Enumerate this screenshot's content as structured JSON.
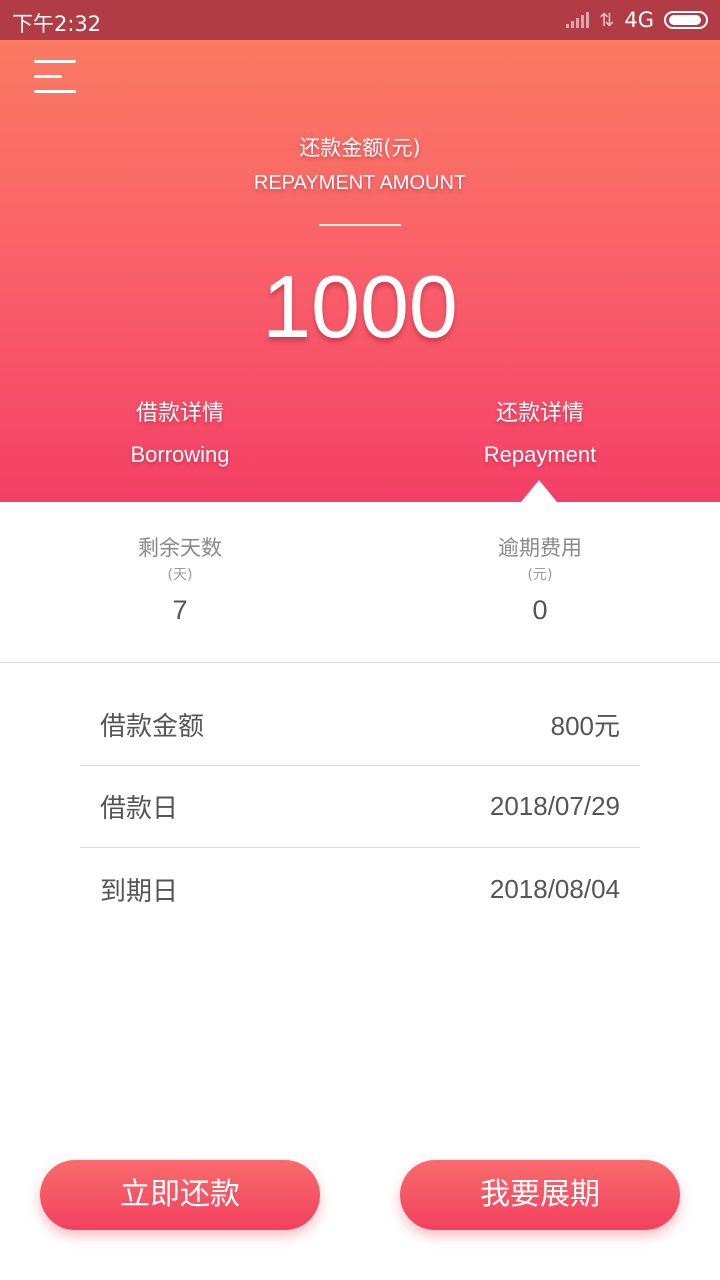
{
  "status_bar": {
    "time": "下午2:32",
    "network": "4G"
  },
  "hero": {
    "title_cn": "还款金额(元)",
    "title_en": "REPAYMENT AMOUNT",
    "amount": "1000",
    "tabs": [
      {
        "cn": "借款详情",
        "en": "Borrowing",
        "active": false
      },
      {
        "cn": "还款详情",
        "en": "Repayment",
        "active": true
      }
    ]
  },
  "stats": [
    {
      "label": "剩余天数",
      "unit": "(天)",
      "value": "7"
    },
    {
      "label": "逾期费用",
      "unit": "(元)",
      "value": "0"
    }
  ],
  "details": [
    {
      "label": "借款金额",
      "value": "800元"
    },
    {
      "label": "借款日",
      "value": "2018/07/29"
    },
    {
      "label": "到期日",
      "value": "2018/08/04"
    }
  ],
  "buttons": {
    "repay_now": "立即还款",
    "extend": "我要展期"
  },
  "colors": {
    "status_bar": "#b13c45",
    "hero_top": "#fb7a62",
    "hero_bottom": "#f43f66",
    "button": "#f2405f",
    "text_dark": "#555555",
    "text_muted": "#8a8a8a"
  },
  "icons": [
    "menu-icon",
    "signal-icon",
    "data-arrows-icon",
    "battery-icon"
  ]
}
